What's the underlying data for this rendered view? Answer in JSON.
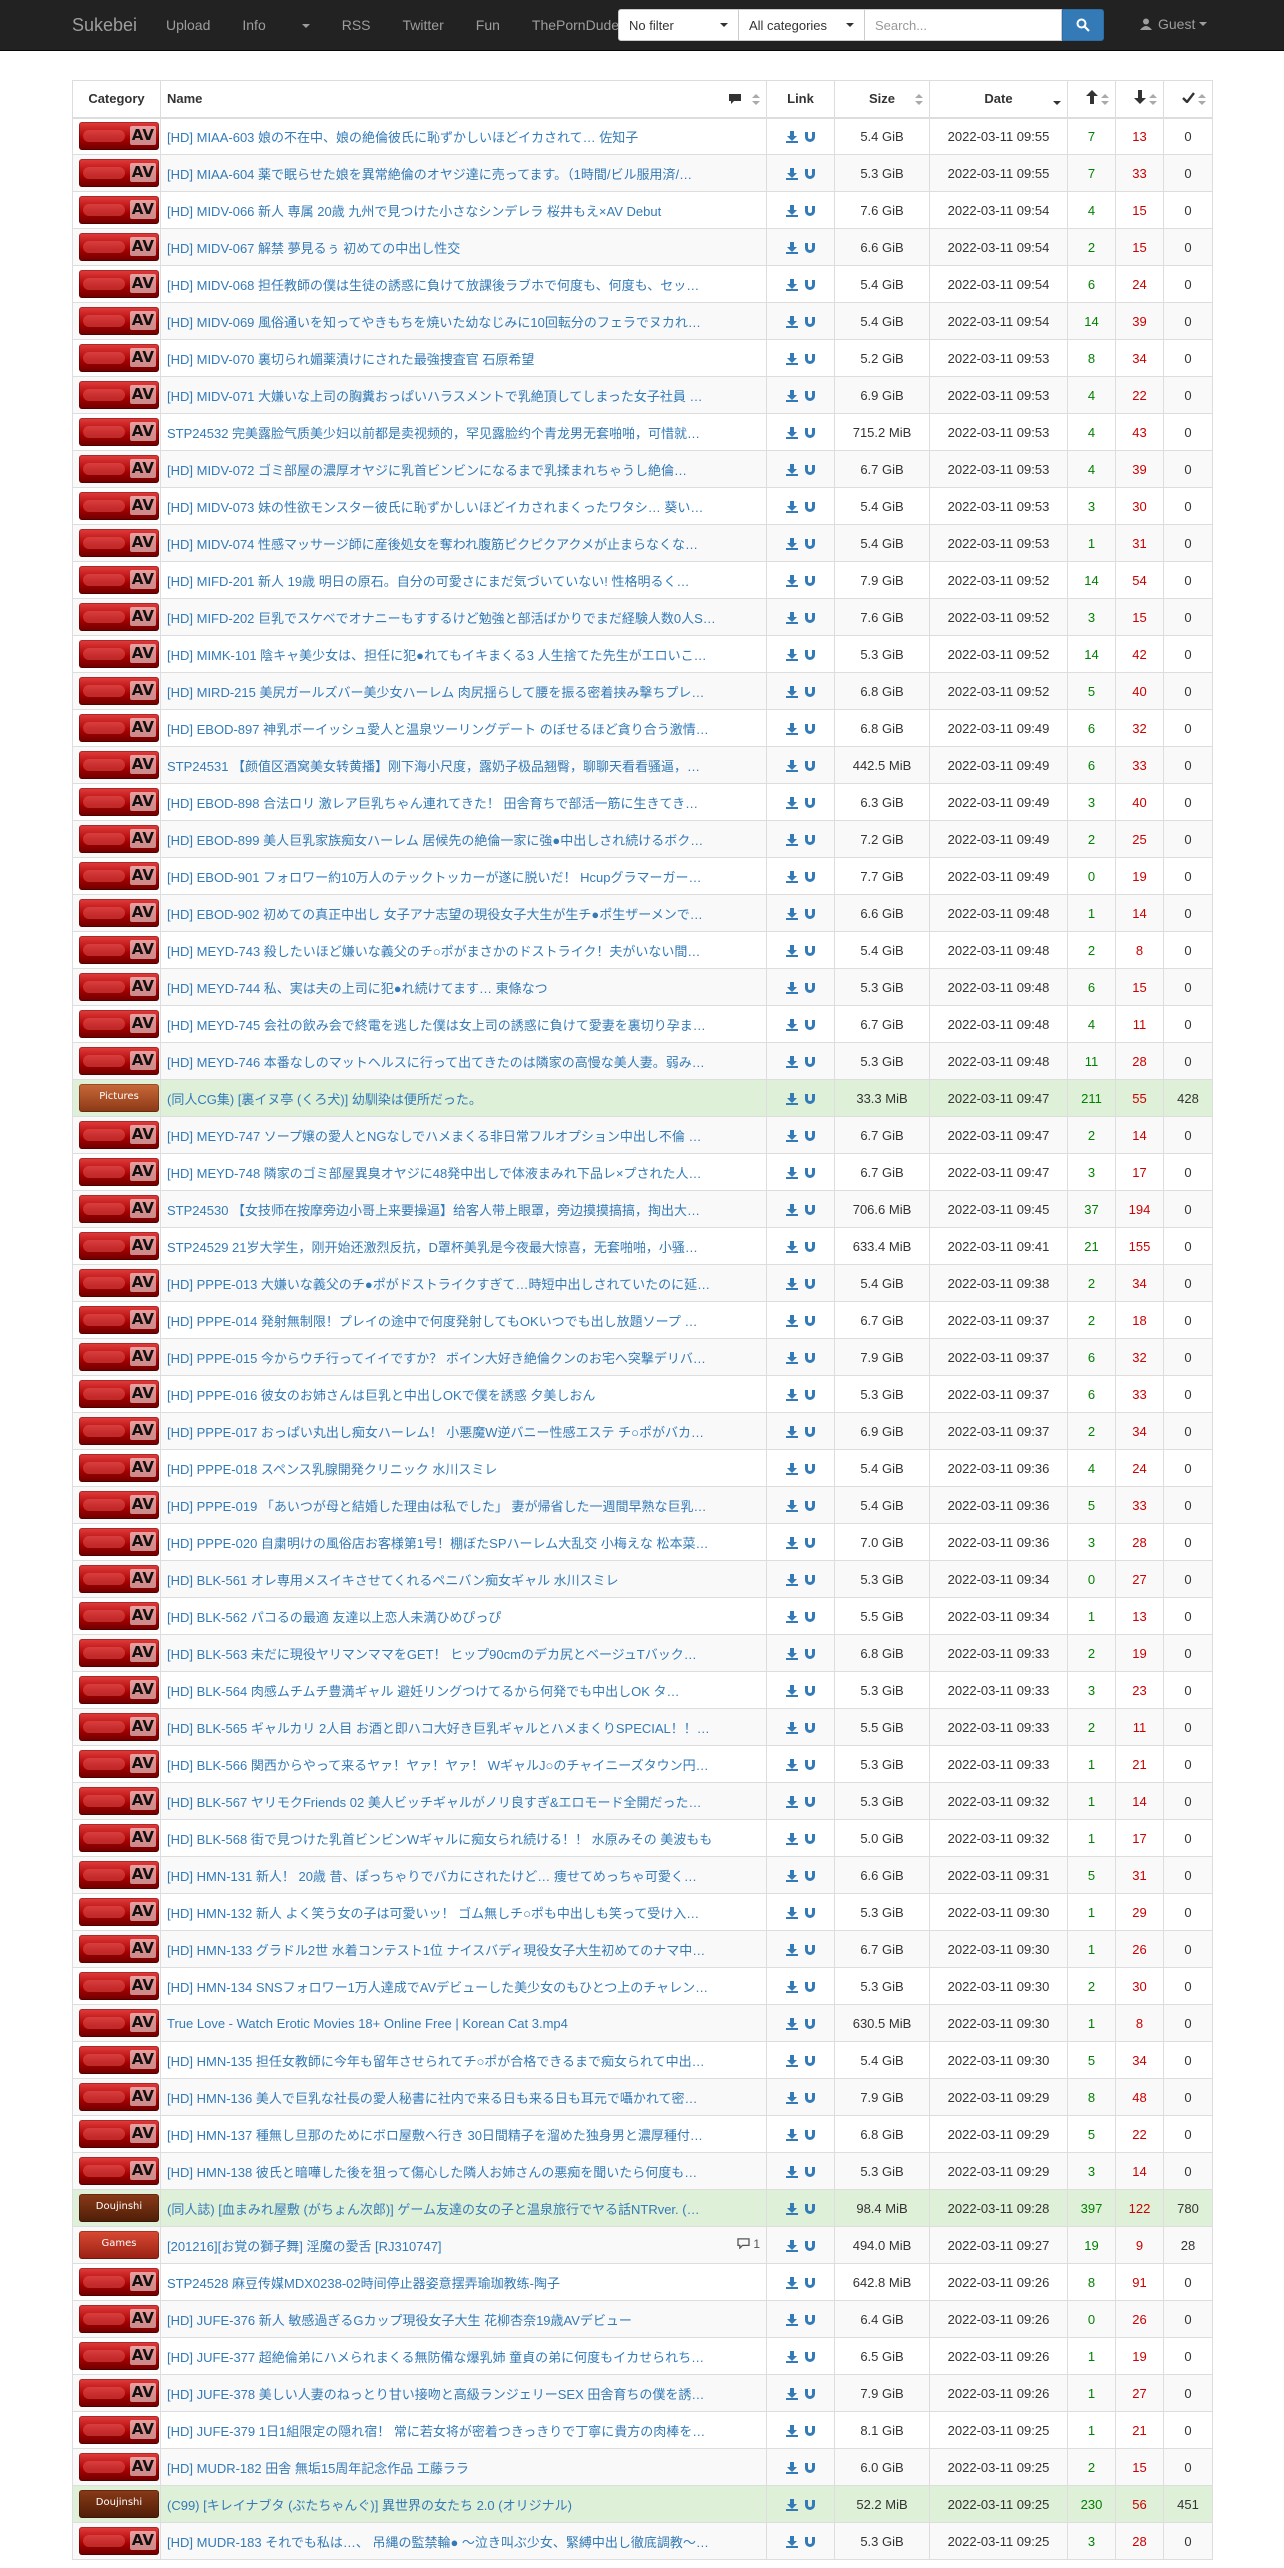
{
  "nav": {
    "brand": "Sukebei",
    "links": [
      "Upload",
      "Info",
      "RSS",
      "Twitter",
      "Fun",
      "ThePornDude"
    ],
    "filter": "No filter",
    "category": "All categories",
    "search_placeholder": "Search...",
    "user": "Guest"
  },
  "table": {
    "headers": {
      "category": "Category",
      "name": "Name",
      "link": "Link",
      "size": "Size",
      "date": "Date"
    },
    "rows": [
      {
        "c": "AV",
        "n": "[HD] MIAA-603 娘の不在中、娘の絶倫彼氏に恥ずかしいほどイカされて… 佐知子",
        "s": "5.4 GiB",
        "d": "2022-03-11 09:55",
        "se": "7",
        "le": "13",
        "co": "0",
        "t": "default"
      },
      {
        "c": "AV",
        "n": "[HD] MIAA-604 薬で眠らせた娘を異常絶倫のオヤジ達に売ってます。（1時間/ビル服用済/…",
        "s": "5.3 GiB",
        "d": "2022-03-11 09:55",
        "se": "7",
        "le": "33",
        "co": "0",
        "t": "default"
      },
      {
        "c": "AV",
        "n": "[HD] MIDV-066 新人 専属 20歳 九州で見つけた小さなシンデレラ 桜井もえ×AV Debut",
        "s": "7.6 GiB",
        "d": "2022-03-11 09:54",
        "se": "4",
        "le": "15",
        "co": "0",
        "t": "default"
      },
      {
        "c": "AV",
        "n": "[HD] MIDV-067 解禁 夢見るぅ 初めての中出し性交",
        "s": "6.6 GiB",
        "d": "2022-03-11 09:54",
        "se": "2",
        "le": "15",
        "co": "0",
        "t": "default"
      },
      {
        "c": "AV",
        "n": "[HD] MIDV-068 担任教師の僕は生徒の誘惑に負けて放課後ラブホで何度も、何度も、セッ…",
        "s": "5.4 GiB",
        "d": "2022-03-11 09:54",
        "se": "6",
        "le": "24",
        "co": "0",
        "t": "default"
      },
      {
        "c": "AV",
        "n": "[HD] MIDV-069 風俗通いを知ってやきもちを焼いた幼なじみに10回転分のフェラでヌカれ…",
        "s": "5.4 GiB",
        "d": "2022-03-11 09:54",
        "se": "14",
        "le": "39",
        "co": "0",
        "t": "default"
      },
      {
        "c": "AV",
        "n": "[HD] MIDV-070 裏切られ媚薬漬けにされた最強捜査官 石原希望",
        "s": "5.2 GiB",
        "d": "2022-03-11 09:53",
        "se": "8",
        "le": "34",
        "co": "0",
        "t": "default"
      },
      {
        "c": "AV",
        "n": "[HD] MIDV-071 大嫌いな上司の胸糞おっぱいハラスメントで乳絶頂してしまった女子社員 …",
        "s": "6.9 GiB",
        "d": "2022-03-11 09:53",
        "se": "4",
        "le": "22",
        "co": "0",
        "t": "default"
      },
      {
        "c": "AV",
        "n": "STP24532 完美露脸气质美少妇以前都是卖视频的，罕见露脸约个青龙男无套啪啪，可惜就…",
        "s": "715.2 MiB",
        "d": "2022-03-11 09:53",
        "se": "4",
        "le": "43",
        "co": "0",
        "t": "default"
      },
      {
        "c": "AV",
        "n": "[HD] MIDV-072 ゴミ部屋の濃厚オヤジに乳首ビンビンになるまで乳揉まれちゃうし絶倫…",
        "s": "6.7 GiB",
        "d": "2022-03-11 09:53",
        "se": "4",
        "le": "39",
        "co": "0",
        "t": "default"
      },
      {
        "c": "AV",
        "n": "[HD] MIDV-073 妹の性欲モンスター彼氏に恥ずかしいほどイカされまくったワタシ… 葵い…",
        "s": "5.4 GiB",
        "d": "2022-03-11 09:53",
        "se": "3",
        "le": "30",
        "co": "0",
        "t": "default"
      },
      {
        "c": "AV",
        "n": "[HD] MIDV-074 性感マッサージ師に産後処女を奪われ腹筋ピクピクアクメが止まらなくな…",
        "s": "5.4 GiB",
        "d": "2022-03-11 09:53",
        "se": "1",
        "le": "31",
        "co": "0",
        "t": "default"
      },
      {
        "c": "AV",
        "n": "[HD] MIFD-201 新人 19歳 明日の原石。自分の可愛さにまだ気づいていない! 性格明るく…",
        "s": "7.9 GiB",
        "d": "2022-03-11 09:52",
        "se": "14",
        "le": "54",
        "co": "0",
        "t": "default"
      },
      {
        "c": "AV",
        "n": "[HD] MIFD-202 巨乳でスケベでオナニーもすするけど勉強と部活ばかりでまだ経験人数0人S…",
        "s": "7.6 GiB",
        "d": "2022-03-11 09:52",
        "se": "3",
        "le": "15",
        "co": "0",
        "t": "default"
      },
      {
        "c": "AV",
        "n": "[HD] MIMK-101 陰キャ美少女は、担任に犯●れてもイキまくる3 人生捨てた先生がエロいこ…",
        "s": "5.3 GiB",
        "d": "2022-03-11 09:52",
        "se": "14",
        "le": "42",
        "co": "0",
        "t": "default"
      },
      {
        "c": "AV",
        "n": "[HD] MIRD-215 美尻ガールズバー美少女ハーレム 肉尻揺らして腰を振る密着挟み撃ちプレ…",
        "s": "6.8 GiB",
        "d": "2022-03-11 09:52",
        "se": "5",
        "le": "40",
        "co": "0",
        "t": "default"
      },
      {
        "c": "AV",
        "n": "[HD] EBOD-897 神乳ボーイッシュ愛人と温泉ツーリングデート のぼせるほど貪り合う激情…",
        "s": "6.8 GiB",
        "d": "2022-03-11 09:49",
        "se": "6",
        "le": "32",
        "co": "0",
        "t": "default"
      },
      {
        "c": "AV",
        "n": "STP24531 【颜值区酒窝美女转黄播】刚下海小尺度，露奶子极品翘臀，聊聊天看看骚逼，…",
        "s": "442.5 MiB",
        "d": "2022-03-11 09:49",
        "se": "6",
        "le": "33",
        "co": "0",
        "t": "default"
      },
      {
        "c": "AV",
        "n": "[HD] EBOD-898 合法ロリ 激レア巨乳ちゃん連れてきた！ 田舎育ちで部活一筋に生きてき…",
        "s": "6.3 GiB",
        "d": "2022-03-11 09:49",
        "se": "3",
        "le": "40",
        "co": "0",
        "t": "default"
      },
      {
        "c": "AV",
        "n": "[HD] EBOD-899 美人巨乳家族痴女ハーレム 居候先の絶倫一家に強●中出しされ続けるボク…",
        "s": "7.2 GiB",
        "d": "2022-03-11 09:49",
        "se": "2",
        "le": "25",
        "co": "0",
        "t": "default"
      },
      {
        "c": "AV",
        "n": "[HD] EBOD-901 フォロワー約10万人のテックトッカーが遂に脱いだ！ Hcupグラマーガー…",
        "s": "7.7 GiB",
        "d": "2022-03-11 09:49",
        "se": "0",
        "le": "19",
        "co": "0",
        "t": "default"
      },
      {
        "c": "AV",
        "n": "[HD] EBOD-902 初めての真正中出し 女子アナ志望の現役女子大生が生チ●ポ生ザーメンで…",
        "s": "6.6 GiB",
        "d": "2022-03-11 09:48",
        "se": "1",
        "le": "14",
        "co": "0",
        "t": "default"
      },
      {
        "c": "AV",
        "n": "[HD] MEYD-743 殺したいほど嫌いな義父のチ○ポがまさかのドストライク！夫がいない間…",
        "s": "5.4 GiB",
        "d": "2022-03-11 09:48",
        "se": "2",
        "le": "8",
        "co": "0",
        "t": "default"
      },
      {
        "c": "AV",
        "n": "[HD] MEYD-744 私、実は夫の上司に犯●れ続けてます… 東條なつ",
        "s": "5.3 GiB",
        "d": "2022-03-11 09:48",
        "se": "6",
        "le": "15",
        "co": "0",
        "t": "default"
      },
      {
        "c": "AV",
        "n": "[HD] MEYD-745 会社の飲み会で終電を逃した僕は女上司の誘惑に負けて愛妻を裏切り孕ま…",
        "s": "6.7 GiB",
        "d": "2022-03-11 09:48",
        "se": "4",
        "le": "11",
        "co": "0",
        "t": "default"
      },
      {
        "c": "AV",
        "n": "[HD] MEYD-746 本番なしのマットヘルスに行って出てきたのは隣家の高慢な美人妻。弱み…",
        "s": "5.3 GiB",
        "d": "2022-03-11 09:48",
        "se": "11",
        "le": "28",
        "co": "0",
        "t": "default"
      },
      {
        "c": "Pictures",
        "n": "(同人CG集) [裏イヌ亭 (くろ犬)] 幼馴染は便所だった。",
        "s": "33.3 MiB",
        "d": "2022-03-11 09:47",
        "se": "211",
        "le": "55",
        "co": "428",
        "t": "success"
      },
      {
        "c": "AV",
        "n": "[HD] MEYD-747 ソープ嬢の愛人とNGなしでハメまくる非日常フルオプション中出し不倫 …",
        "s": "6.7 GiB",
        "d": "2022-03-11 09:47",
        "se": "2",
        "le": "14",
        "co": "0",
        "t": "default"
      },
      {
        "c": "AV",
        "n": "[HD] MEYD-748 隣家のゴミ部屋異臭オヤジに48発中出しで体液まみれ下品レ×プされた人…",
        "s": "6.7 GiB",
        "d": "2022-03-11 09:47",
        "se": "3",
        "le": "17",
        "co": "0",
        "t": "default"
      },
      {
        "c": "AV",
        "n": "STP24530 【女技师在按摩旁边小哥上来要操逼】给客人带上眼罩，旁边摸摸搞搞，掏出大…",
        "s": "706.6 MiB",
        "d": "2022-03-11 09:45",
        "se": "37",
        "le": "194",
        "co": "0",
        "t": "default"
      },
      {
        "c": "AV",
        "n": "STP24529 21岁大学生，刚开始还激烈反抗，D罩杯美乳是今夜最大惊喜，无套啪啪，小骚…",
        "s": "633.4 MiB",
        "d": "2022-03-11 09:41",
        "se": "21",
        "le": "155",
        "co": "0",
        "t": "default"
      },
      {
        "c": "AV",
        "n": "[HD] PPPE-013 大嫌いな義父のチ●ポがドストライクすぎて…時短中出しされていたのに延…",
        "s": "5.4 GiB",
        "d": "2022-03-11 09:38",
        "se": "2",
        "le": "34",
        "co": "0",
        "t": "default"
      },
      {
        "c": "AV",
        "n": "[HD] PPPE-014 発射無制限！プレイの途中で何度発射してもOKいつでも出し放題ソープ …",
        "s": "6.7 GiB",
        "d": "2022-03-11 09:37",
        "se": "2",
        "le": "18",
        "co": "0",
        "t": "default"
      },
      {
        "c": "AV",
        "n": "[HD] PPPE-015 今からウチ行ってイイですか？ ボイン大好き絶倫クンのお宅へ突撃デリバ…",
        "s": "7.9 GiB",
        "d": "2022-03-11 09:37",
        "se": "6",
        "le": "32",
        "co": "0",
        "t": "default"
      },
      {
        "c": "AV",
        "n": "[HD] PPPE-016 彼女のお姉さんは巨乳と中出しOKで僕を誘惑 夕美しおん",
        "s": "5.3 GiB",
        "d": "2022-03-11 09:37",
        "se": "6",
        "le": "33",
        "co": "0",
        "t": "default"
      },
      {
        "c": "AV",
        "n": "[HD] PPPE-017 おっぱい丸出し痴女ハーレム！ 小悪魔W逆バニー性感エステ チ○ポがバカ…",
        "s": "6.9 GiB",
        "d": "2022-03-11 09:37",
        "se": "2",
        "le": "34",
        "co": "0",
        "t": "default"
      },
      {
        "c": "AV",
        "n": "[HD] PPPE-018 スペンス乳腺開発クリニック 水川スミレ",
        "s": "5.4 GiB",
        "d": "2022-03-11 09:36",
        "se": "4",
        "le": "24",
        "co": "0",
        "t": "default"
      },
      {
        "c": "AV",
        "n": "[HD] PPPE-019 「あいつが母と結婚した理由は私でした」 妻が帰省した一週間早熟な巨乳…",
        "s": "5.4 GiB",
        "d": "2022-03-11 09:36",
        "se": "5",
        "le": "33",
        "co": "0",
        "t": "default"
      },
      {
        "c": "AV",
        "n": "[HD] PPPE-020 自粛明けの風俗店お客様第1号！棚ぼたSPハーレム大乱交 小梅えな 松本菜…",
        "s": "7.0 GiB",
        "d": "2022-03-11 09:36",
        "se": "3",
        "le": "28",
        "co": "0",
        "t": "default"
      },
      {
        "c": "AV",
        "n": "[HD] BLK-561 オレ専用メスイキさせてくれるペニバン痴女ギャル 水川スミレ",
        "s": "5.3 GiB",
        "d": "2022-03-11 09:34",
        "se": "0",
        "le": "27",
        "co": "0",
        "t": "default"
      },
      {
        "c": "AV",
        "n": "[HD] BLK-562 パコるの最適 友達以上恋人未満ひめぴっぴ",
        "s": "5.5 GiB",
        "d": "2022-03-11 09:34",
        "se": "1",
        "le": "13",
        "co": "0",
        "t": "default"
      },
      {
        "c": "AV",
        "n": "[HD] BLK-563 未だに現役ヤリマンママをGET！ ヒップ90cmのデカ尻とベージュTバック…",
        "s": "6.8 GiB",
        "d": "2022-03-11 09:33",
        "se": "2",
        "le": "19",
        "co": "0",
        "t": "default"
      },
      {
        "c": "AV",
        "n": "[HD] BLK-564 肉感ムチムチ豊満ギャル 避妊リングつけてるから何発でも中出しOK タ…",
        "s": "5.3 GiB",
        "d": "2022-03-11 09:33",
        "se": "3",
        "le": "23",
        "co": "0",
        "t": "default"
      },
      {
        "c": "AV",
        "n": "[HD] BLK-565 ギャルカリ 2人目 お酒と即ハコ大好き巨乳ギャルとハメまくりSPECIAL！！…",
        "s": "5.5 GiB",
        "d": "2022-03-11 09:33",
        "se": "2",
        "le": "11",
        "co": "0",
        "t": "default"
      },
      {
        "c": "AV",
        "n": "[HD] BLK-566 関西からやって来るヤァ！ヤァ！ヤァ！ WギャルJ○のチャイニーズタウン円…",
        "s": "5.3 GiB",
        "d": "2022-03-11 09:33",
        "se": "1",
        "le": "21",
        "co": "0",
        "t": "default"
      },
      {
        "c": "AV",
        "n": "[HD] BLK-567 ヤリモクFriends 02 美人ビッチギャルがノリ良すぎ&エロモード全開だった…",
        "s": "5.3 GiB",
        "d": "2022-03-11 09:32",
        "se": "1",
        "le": "14",
        "co": "0",
        "t": "default"
      },
      {
        "c": "AV",
        "n": "[HD] BLK-568 街で見つけた乳首ビンビンWギャルに痴女られ続ける！！ 水原みその 美波もも",
        "s": "5.0 GiB",
        "d": "2022-03-11 09:32",
        "se": "1",
        "le": "17",
        "co": "0",
        "t": "default"
      },
      {
        "c": "AV",
        "n": "[HD] HMN-131 新人！ 20歳 昔、ぽっちゃりでバカにされたけど… 痩せてめっちゃ可愛く…",
        "s": "6.6 GiB",
        "d": "2022-03-11 09:31",
        "se": "5",
        "le": "31",
        "co": "0",
        "t": "default"
      },
      {
        "c": "AV",
        "n": "[HD] HMN-132 新人 よく笑う女の子は可愛いッ！ ゴム無しチ○ポも中出しも笑って受け入…",
        "s": "5.3 GiB",
        "d": "2022-03-11 09:30",
        "se": "1",
        "le": "29",
        "co": "0",
        "t": "default"
      },
      {
        "c": "AV",
        "n": "[HD] HMN-133 グラドル2世 水着コンテスト1位 ナイスバディ現役女子大生初めてのナマ中…",
        "s": "6.7 GiB",
        "d": "2022-03-11 09:30",
        "se": "1",
        "le": "26",
        "co": "0",
        "t": "default"
      },
      {
        "c": "AV",
        "n": "[HD] HMN-134 SNSフォロワー1万人達成でAVデビューした美少女のもひとつ上のチャレン…",
        "s": "5.3 GiB",
        "d": "2022-03-11 09:30",
        "se": "2",
        "le": "30",
        "co": "0",
        "t": "default"
      },
      {
        "c": "AV",
        "n": "True Love - Watch Erotic Movies 18+ Online Free | Korean Cat 3.mp4",
        "s": "630.5 MiB",
        "d": "2022-03-11 09:30",
        "se": "1",
        "le": "8",
        "co": "0",
        "t": "default"
      },
      {
        "c": "AV",
        "n": "[HD] HMN-135 担任女教師に今年も留年させられてチ○ポが合格できるまで痴女られて中出…",
        "s": "5.4 GiB",
        "d": "2022-03-11 09:30",
        "se": "5",
        "le": "34",
        "co": "0",
        "t": "default"
      },
      {
        "c": "AV",
        "n": "[HD] HMN-136 美人で巨乳な社長の愛人秘書に社内で来る日も来る日も耳元で囁かれて密…",
        "s": "7.9 GiB",
        "d": "2022-03-11 09:29",
        "se": "8",
        "le": "48",
        "co": "0",
        "t": "default"
      },
      {
        "c": "AV",
        "n": "[HD] HMN-137 種無し旦那のためにボロ屋敷へ行き 30日間精子を溜めた独身男と濃厚種付…",
        "s": "6.8 GiB",
        "d": "2022-03-11 09:29",
        "se": "5",
        "le": "22",
        "co": "0",
        "t": "default"
      },
      {
        "c": "AV",
        "n": "[HD] HMN-138 彼氏と暗嘩した後を狙って傷心した隣人お姉さんの悪痴を聞いたら何度も…",
        "s": "5.3 GiB",
        "d": "2022-03-11 09:29",
        "se": "3",
        "le": "14",
        "co": "0",
        "t": "default"
      },
      {
        "c": "Doujinshi",
        "n": "(同人誌) [血まみれ屋敷 (がちょん次郎)] ゲーム友達の女の子と温泉旅行でヤる話NTRver. (…",
        "s": "98.4 MiB",
        "d": "2022-03-11 09:28",
        "se": "397",
        "le": "122",
        "co": "780",
        "t": "success"
      },
      {
        "c": "Games",
        "n": "[201216][お覚の獅子舞] 淫魔の愛舌 [RJ310747]",
        "s": "494.0 MiB",
        "d": "2022-03-11 09:27",
        "se": "19",
        "le": "9",
        "co": "28",
        "t": "default",
        "cm": "1"
      },
      {
        "c": "AV",
        "n": "STP24528 麻豆传媒MDX0238-02時间停止器姿意摆弄瑜珈教练-陶子",
        "s": "642.8 MiB",
        "d": "2022-03-11 09:26",
        "se": "8",
        "le": "91",
        "co": "0",
        "t": "default"
      },
      {
        "c": "AV",
        "n": "[HD] JUFE-376 新人 敏感過ぎるGカップ現役女子大生 花柳杏奈19歳AVデビュー",
        "s": "6.4 GiB",
        "d": "2022-03-11 09:26",
        "se": "0",
        "le": "26",
        "co": "0",
        "t": "default"
      },
      {
        "c": "AV",
        "n": "[HD] JUFE-377 超絶倫弟にハメられまくる無防備な爆乳姉 童貞の弟に何度もイカせられち…",
        "s": "6.5 GiB",
        "d": "2022-03-11 09:26",
        "se": "1",
        "le": "19",
        "co": "0",
        "t": "default"
      },
      {
        "c": "AV",
        "n": "[HD] JUFE-378 美しい人妻のねっとり甘い接吻と高級ランジェリーSEX 田舎育ちの僕を誘…",
        "s": "7.9 GiB",
        "d": "2022-03-11 09:26",
        "se": "1",
        "le": "27",
        "co": "0",
        "t": "default"
      },
      {
        "c": "AV",
        "n": "[HD] JUFE-379 1日1組限定の隠れ宿！ 常に若女将が密着つきっきりで丁寧に貴方の肉棒を…",
        "s": "8.1 GiB",
        "d": "2022-03-11 09:25",
        "se": "1",
        "le": "21",
        "co": "0",
        "t": "default"
      },
      {
        "c": "AV",
        "n": "[HD] MUDR-182 田舎 無垢15周年記念作品 工藤ララ",
        "s": "6.0 GiB",
        "d": "2022-03-11 09:25",
        "se": "2",
        "le": "15",
        "co": "0",
        "t": "default"
      },
      {
        "c": "Doujinshi",
        "n": "(C99) [キレイナブタ (ぶたちゃんぐ)] 異世界の女たち 2.0 (オリジナル)",
        "s": "52.2 MiB",
        "d": "2022-03-11 09:25",
        "se": "230",
        "le": "56",
        "co": "451",
        "t": "success"
      },
      {
        "c": "AV",
        "n": "[HD] MUDR-183 それでも私は…、 吊縄の監禁輪● ～泣き叫ぶ少女、緊縛中出し徹底調教～…",
        "s": "5.3 GiB",
        "d": "2022-03-11 09:25",
        "se": "3",
        "le": "28",
        "co": "0",
        "t": "default"
      }
    ]
  }
}
